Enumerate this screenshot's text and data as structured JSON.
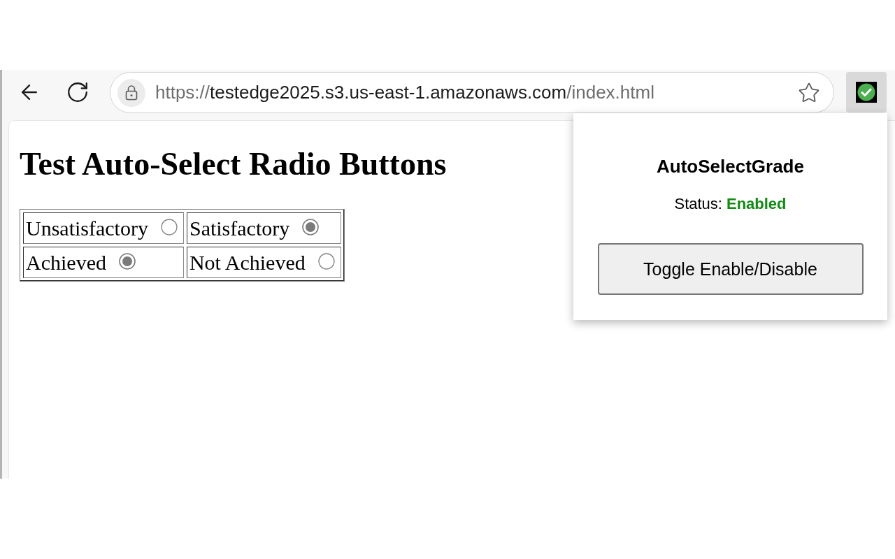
{
  "toolbar": {
    "url": {
      "scheme": "https://",
      "host": "testedge2025.s3.us-east-1.amazonaws.com",
      "path": "/index.html"
    }
  },
  "page": {
    "heading": "Test Auto-Select Radio Buttons",
    "rows": [
      {
        "cells": [
          {
            "label": "Unsatisfactory",
            "selected": false
          },
          {
            "label": "Satisfactory",
            "selected": true
          }
        ]
      },
      {
        "cells": [
          {
            "label": "Achieved",
            "selected": true
          },
          {
            "label": "Not Achieved",
            "selected": false
          }
        ]
      }
    ]
  },
  "extension_popup": {
    "title": "AutoSelectGrade",
    "status_label": "Status:",
    "status_value": "Enabled",
    "enabled": true,
    "button": "Toggle Enable/Disable"
  }
}
